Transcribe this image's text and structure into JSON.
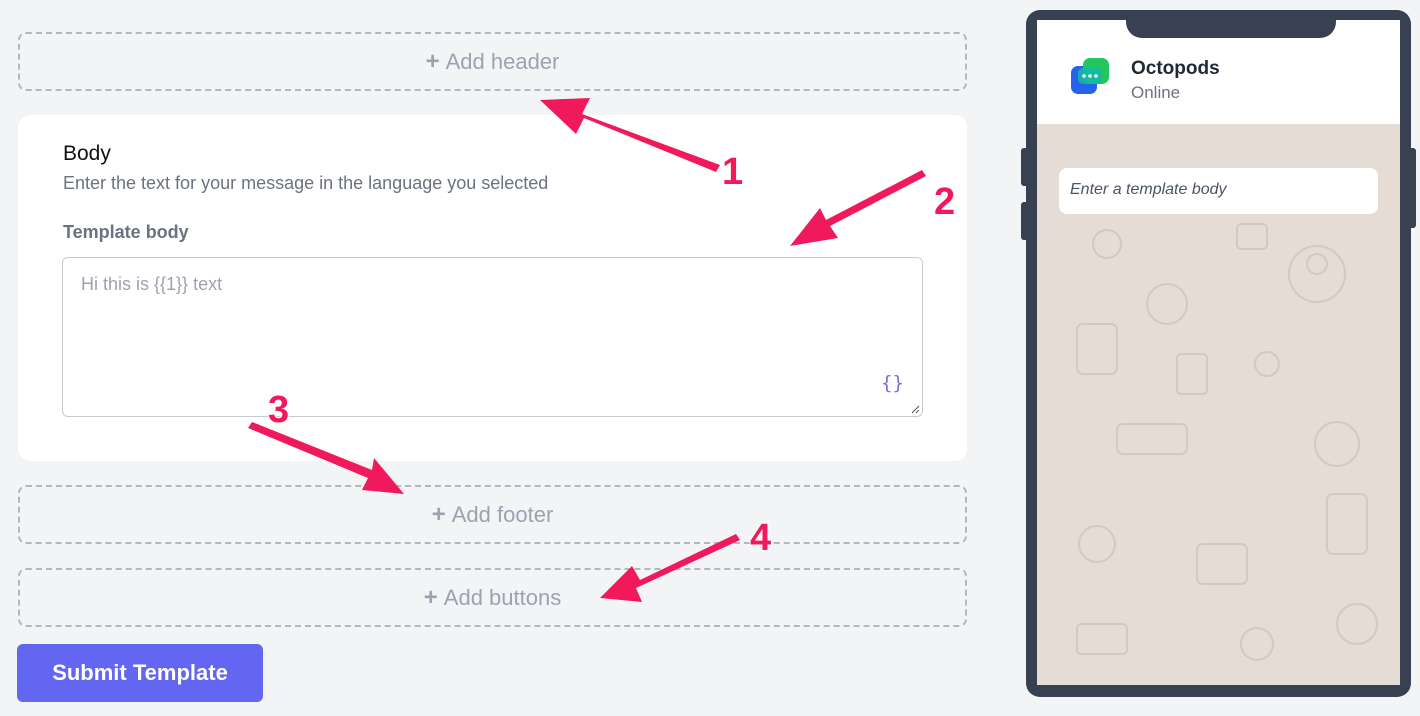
{
  "editor": {
    "add_header": "Add header",
    "add_footer": "Add footer",
    "add_buttons": "Add buttons",
    "plus_symbol": "+",
    "body": {
      "title": "Body",
      "description": "Enter the text for your message in the language you selected",
      "field_label": "Template body",
      "placeholder": "Hi this is {{1}} text",
      "variable_icon": "{}"
    },
    "submit_label": "Submit Template"
  },
  "preview": {
    "contact_name": "Octopods",
    "contact_status": "Online",
    "message_placeholder": "Enter a template body"
  },
  "annotations": [
    "1",
    "2",
    "3",
    "4"
  ],
  "colors": {
    "accent": "#6366f1",
    "arrow": "#f0195b",
    "phone_frame": "#374151",
    "chat_bg": "#e5ddd5"
  },
  "icons": [
    "plus-icon",
    "variable-braces-icon",
    "octopods-logo-icon",
    "annotation-arrow-icon"
  ]
}
